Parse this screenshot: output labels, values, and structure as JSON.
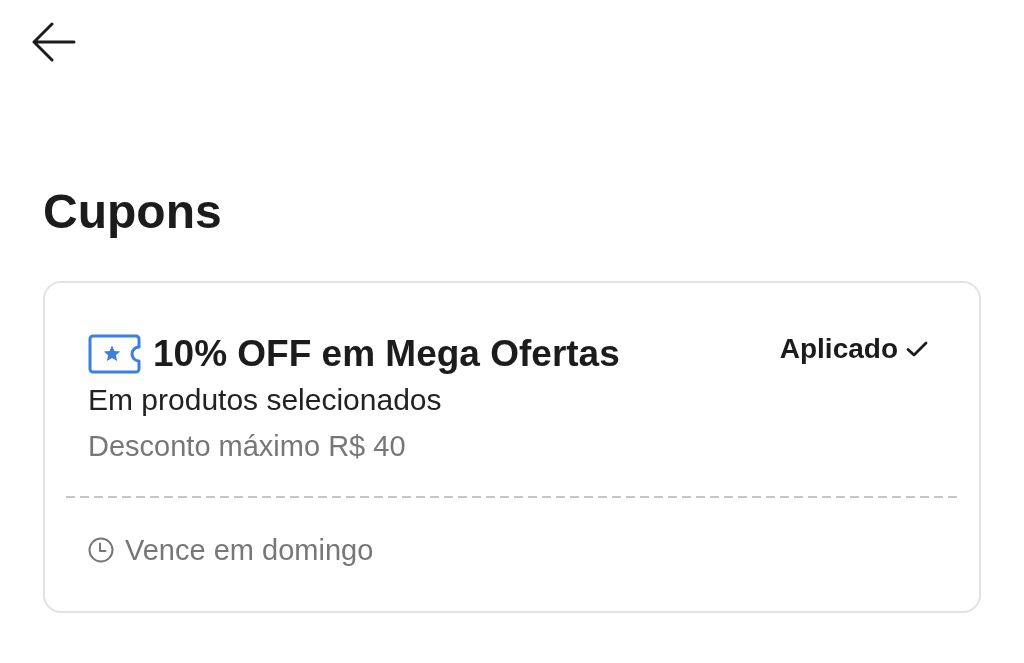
{
  "header": {
    "title": "Cupons"
  },
  "coupons": [
    {
      "title": "10% OFF em Mega Ofertas",
      "status": "Aplicado",
      "applied": true,
      "subtitle": "Em produtos selecionados",
      "limit": "Desconto máximo R$ 40",
      "expiry": "Vence em domingo"
    }
  ]
}
